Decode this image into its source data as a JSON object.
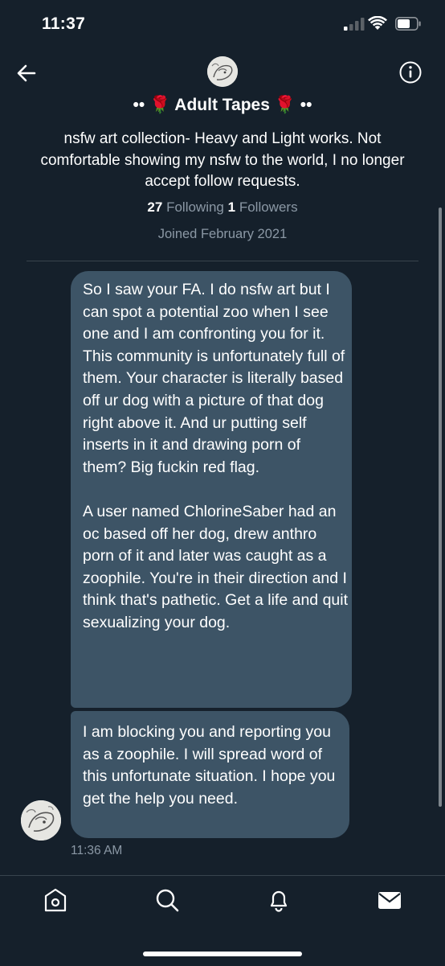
{
  "status_bar": {
    "time": "11:37",
    "icons": [
      "cellular-signal-icon",
      "wifi-icon",
      "battery-icon"
    ]
  },
  "header": {
    "back_icon": "arrow-left-icon",
    "info_icon": "info-circle-icon",
    "avatar": "profile-avatar-drawing"
  },
  "profile": {
    "name": "•• 🌹 Adult Tapes 🌹 ••",
    "bio": "nsfw art collection- Heavy and Light works. Not comfortable showing my nsfw to the world, I no longer accept follow requests.",
    "following_count": "27",
    "following_label": "Following",
    "followers_count": "1",
    "followers_label": "Followers",
    "joined": "Joined February 2021"
  },
  "messages": [
    {
      "paragraphs": [
        "So I saw your FA. I do nsfw art but I can spot a potential zoo when I see one and I am confronting you for it. This community is unfortunately full of them. Your character is literally based off ur dog with a picture of that dog right above it. And ur putting self inserts in it and drawing porn of them? Big fuckin red flag.",
        "A user named ChlorineSaber had an oc based off her dog, drew anthro porn of it and later was caught as a zoophile. You're in their direction and I think that's pathetic. Get a life and quit sexualizing your dog."
      ]
    },
    {
      "paragraphs": [
        "I am blocking you and reporting you as a zoophile. I will spread word of this unfortunate situation. I hope you get the help you need."
      ]
    }
  ],
  "timestamp": "11:36 AM",
  "tab_bar": {
    "tabs": [
      "home-icon",
      "search-icon",
      "notifications-bell-icon",
      "messages-envelope-icon"
    ]
  },
  "colors": {
    "background": "#15202b",
    "bubble": "#3d5466",
    "secondary_text": "#8b98a5",
    "divider": "#38444d"
  }
}
